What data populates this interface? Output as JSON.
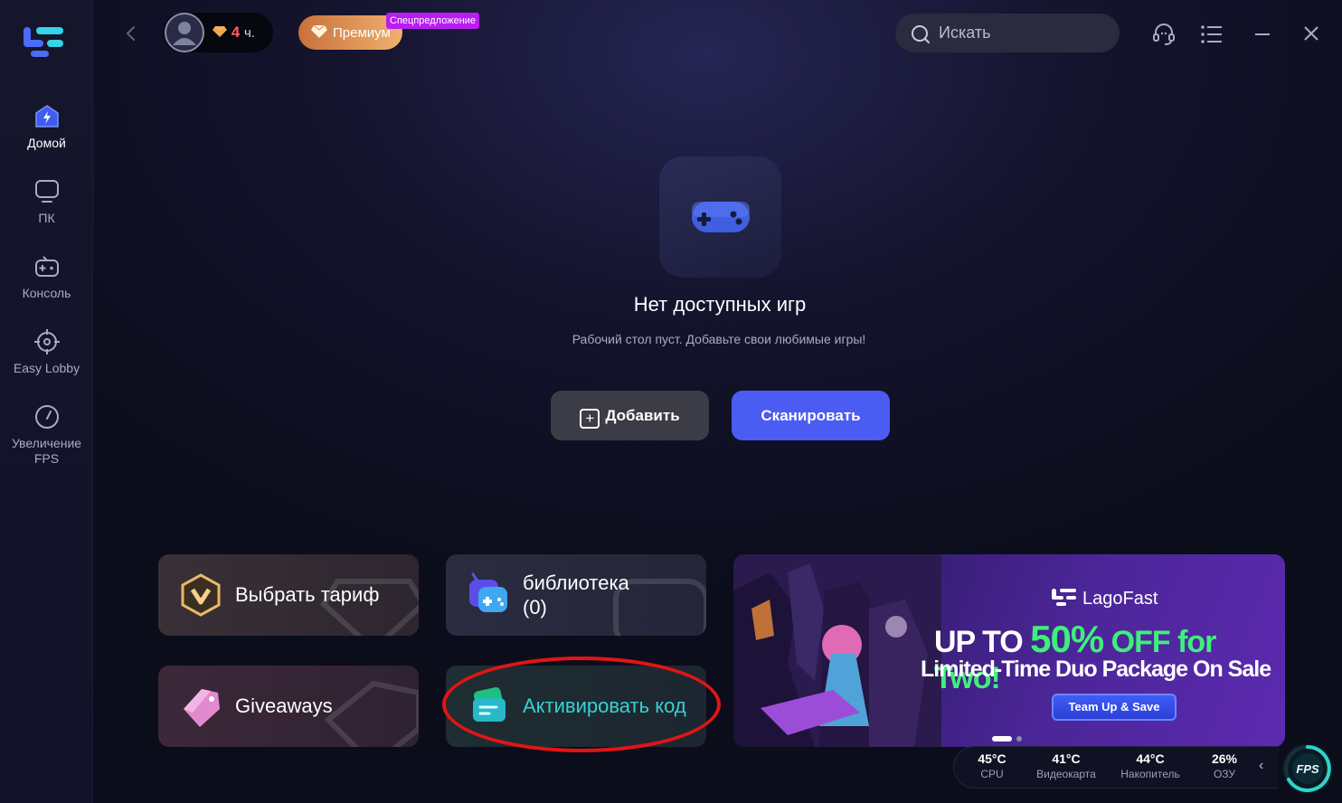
{
  "topbar": {
    "hours_value": "4",
    "hours_unit": "ч.",
    "premium_label": "Премиум",
    "special_badge": "Спецпредложение",
    "search_placeholder": "Искать"
  },
  "sidebar": {
    "items": [
      {
        "label": "Домой",
        "icon": "home-icon",
        "active": true
      },
      {
        "label": "ПК",
        "icon": "monitor-icon",
        "active": false
      },
      {
        "label": "Консоль",
        "icon": "gamepad-icon",
        "active": false
      },
      {
        "label": "Easy Lobby",
        "icon": "crosshair-icon",
        "active": false
      },
      {
        "label": "Увеличение FPS",
        "icon": "speedometer-icon",
        "active": false
      }
    ]
  },
  "empty_state": {
    "title": "Нет доступных игр",
    "subtitle": "Рабочий стол пуст. Добавьте свои любимые игры!",
    "add_label": "Добавить",
    "scan_label": "Сканировать"
  },
  "cards": {
    "plan": "Выбрать тариф",
    "library_line1": "библиотека",
    "library_line2": "(0)",
    "giveaways": "Giveaways",
    "activate": "Активировать код"
  },
  "banner": {
    "brand": "LagoFast",
    "headline_prefix": "UP TO",
    "headline_pct": "50%",
    "headline_suffix": "OFF for Two!",
    "subline": "Limited-Time Duo Package On Sale",
    "cta": "Team Up & Save"
  },
  "status": [
    {
      "value": "45°C",
      "label": "CPU"
    },
    {
      "value": "41°C",
      "label": "Видеокарта"
    },
    {
      "value": "44°C",
      "label": "Накопитель"
    },
    {
      "value": "26%",
      "label": "ОЗУ"
    }
  ],
  "fps_label": "FPS",
  "colors": {
    "accent": "#4a5cf2",
    "activate_text": "#38d1d1",
    "annotation": "#e01515"
  }
}
